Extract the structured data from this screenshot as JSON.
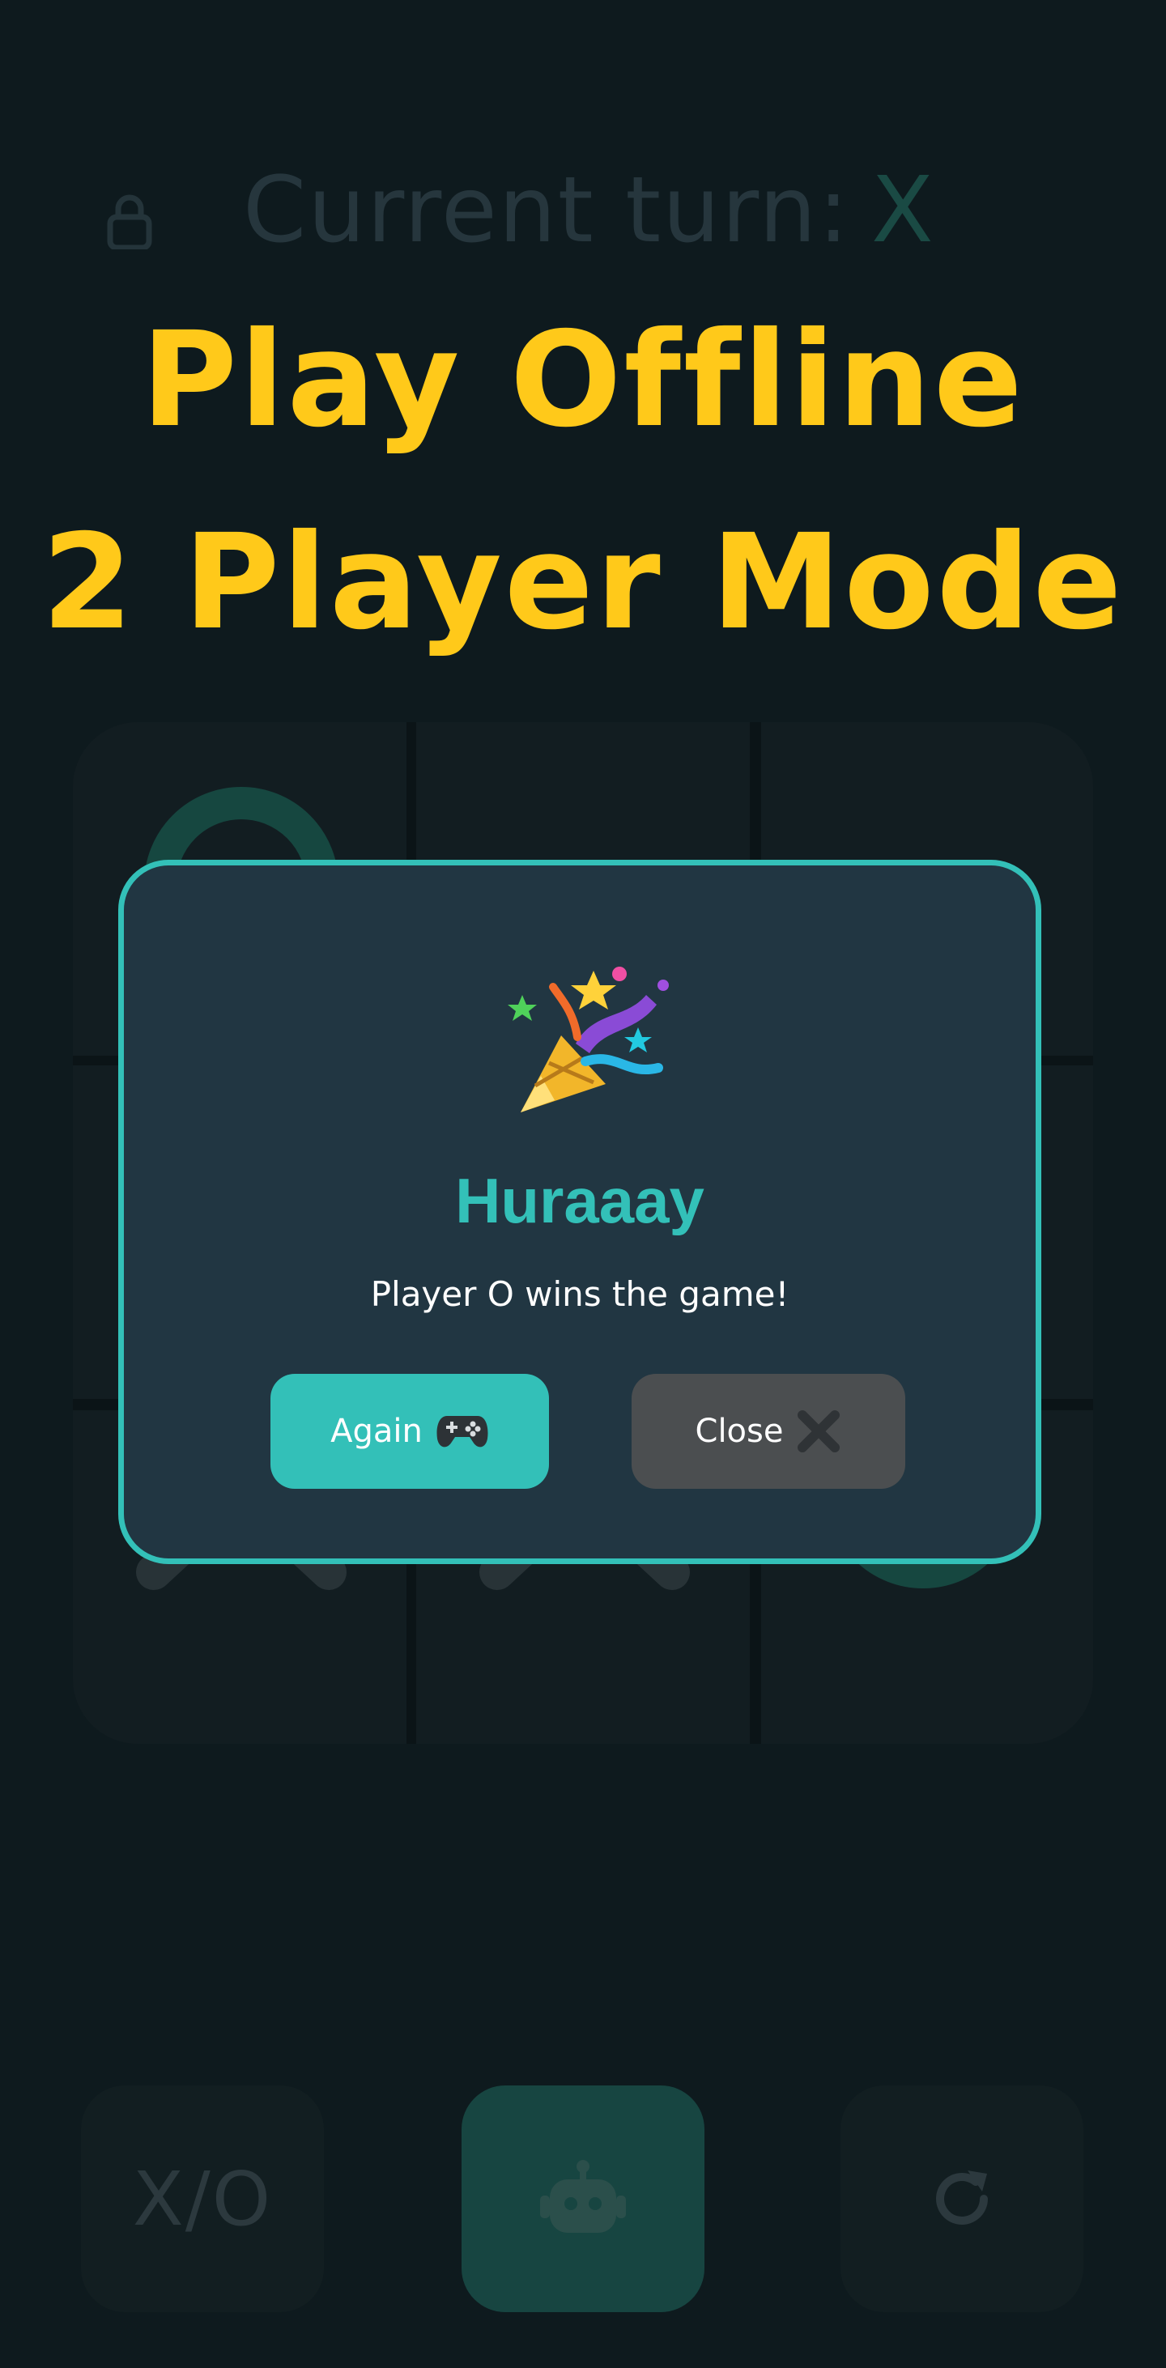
{
  "header": {
    "turn_label": "Current turn:",
    "turn_symbol": "X",
    "lock_icon": "lock-icon"
  },
  "headline": {
    "line1": "Play Offline",
    "line2": "2 Player Mode"
  },
  "board": {
    "cells": [
      "O",
      "",
      "",
      "",
      "",
      "",
      "X",
      "X",
      "O"
    ]
  },
  "dialog": {
    "icon": "party-popper-icon",
    "title": "Huraaay",
    "message": "Player O wins the game!",
    "again_label": "Again",
    "again_icon": "gamepad-icon",
    "close_label": "Close",
    "close_icon": "close-x-icon"
  },
  "controls": {
    "xo_label": "X/O",
    "bot_icon": "robot-icon",
    "reset_icon": "reset-icon"
  },
  "colors": {
    "background": "#0e1a1e",
    "accent": "#33c0b8",
    "headline": "#ffc91a",
    "dialog_bg": "#213642",
    "close_button": "#4b4e50"
  }
}
